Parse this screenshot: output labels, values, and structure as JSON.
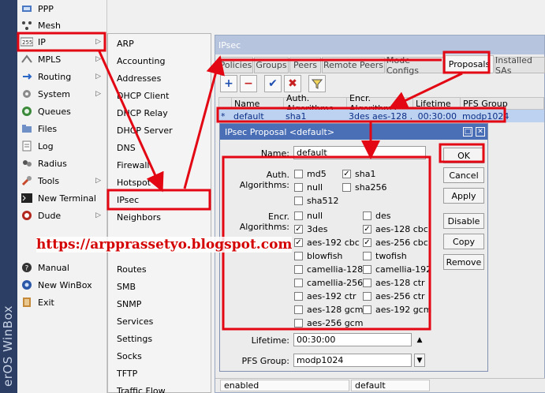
{
  "brand": "erOS WinBox",
  "main_menu": {
    "items": [
      {
        "label": "PPP",
        "icon": "network-icon",
        "arrow": false
      },
      {
        "label": "Mesh",
        "icon": "mesh-icon",
        "arrow": false
      },
      {
        "label": "IP",
        "icon": "ip-icon",
        "arrow": true
      },
      {
        "label": "MPLS",
        "icon": "mpls-icon",
        "arrow": true
      },
      {
        "label": "Routing",
        "icon": "routing-icon",
        "arrow": true
      },
      {
        "label": "System",
        "icon": "gear-icon",
        "arrow": true
      },
      {
        "label": "Queues",
        "icon": "queues-icon",
        "arrow": false
      },
      {
        "label": "Files",
        "icon": "folder-icon",
        "arrow": false
      },
      {
        "label": "Log",
        "icon": "log-icon",
        "arrow": false
      },
      {
        "label": "Radius",
        "icon": "radius-icon",
        "arrow": false
      },
      {
        "label": "Tools",
        "icon": "tools-icon",
        "arrow": true
      },
      {
        "label": "New Terminal",
        "icon": "terminal-icon",
        "arrow": false
      },
      {
        "label": "Dude",
        "icon": "dude-icon",
        "arrow": true
      },
      {
        "label": "Manual",
        "icon": "help-icon",
        "arrow": false
      },
      {
        "label": "New WinBox",
        "icon": "winbox-icon",
        "arrow": false
      },
      {
        "label": "Exit",
        "icon": "exit-icon",
        "arrow": false
      }
    ]
  },
  "submenu": {
    "items": [
      "ARP",
      "Accounting",
      "Addresses",
      "DHCP Client",
      "DHCP Relay",
      "DHCP Server",
      "DNS",
      "Firewall",
      "Hotspot",
      "IPsec",
      "Neighbors",
      "Routes",
      "SMB",
      "SNMP",
      "Services",
      "Settings",
      "Socks",
      "TFTP",
      "Traffic Flow"
    ]
  },
  "ipsec": {
    "title": "IPsec",
    "tabs": [
      "Policies",
      "Groups",
      "Peers",
      "Remote Peers",
      "Mode Configs",
      "Proposals",
      "Installed SAs"
    ],
    "columns": [
      "Name",
      "Auth. Algorithms",
      "Encr. Algorithms",
      "Lifetime",
      "PFS Group"
    ],
    "row": {
      "marker": "*",
      "name": "default",
      "auth": "sha1",
      "encr": "3des aes-128 ...",
      "lifetime": "00:30:00",
      "pfs": "modp1024"
    },
    "status": {
      "state": "enabled",
      "name": "default"
    }
  },
  "dialog": {
    "title": "IPsec Proposal <default>",
    "name_label": "Name:",
    "name_value": "default",
    "auth_label": "Auth. Algorithms:",
    "auth": [
      {
        "label": "md5",
        "checked": false
      },
      {
        "label": "sha1",
        "checked": true
      },
      {
        "label": "null",
        "checked": false
      },
      {
        "label": "sha256",
        "checked": false
      },
      {
        "label": "sha512",
        "checked": false
      }
    ],
    "encr_label": "Encr. Algorithms:",
    "encr": [
      {
        "label": "null",
        "checked": false
      },
      {
        "label": "des",
        "checked": false
      },
      {
        "label": "3des",
        "checked": true
      },
      {
        "label": "aes-128 cbc",
        "checked": true
      },
      {
        "label": "aes-192 cbc",
        "checked": true
      },
      {
        "label": "aes-256 cbc",
        "checked": true
      },
      {
        "label": "blowfish",
        "checked": false
      },
      {
        "label": "twofish",
        "checked": false
      },
      {
        "label": "camellia-128",
        "checked": false
      },
      {
        "label": "camellia-192",
        "checked": false
      },
      {
        "label": "camellia-256",
        "checked": false
      },
      {
        "label": "aes-128 ctr",
        "checked": false
      },
      {
        "label": "aes-192 ctr",
        "checked": false
      },
      {
        "label": "aes-256 ctr",
        "checked": false
      },
      {
        "label": "aes-128 gcm",
        "checked": false
      },
      {
        "label": "aes-192 gcm",
        "checked": false
      },
      {
        "label": "aes-256 gcm",
        "checked": false
      }
    ],
    "lifetime_label": "Lifetime:",
    "lifetime_value": "00:30:00",
    "pfs_label": "PFS Group:",
    "pfs_value": "modp1024",
    "buttons": [
      "OK",
      "Cancel",
      "Apply",
      "Disable",
      "Copy",
      "Remove"
    ]
  },
  "watermark": "https://arpprassetyo.blogspot.com",
  "colors": {
    "annotation": "#e30613",
    "titlebar": "#4a6fb6",
    "selected_row": "#bcd2f0"
  }
}
